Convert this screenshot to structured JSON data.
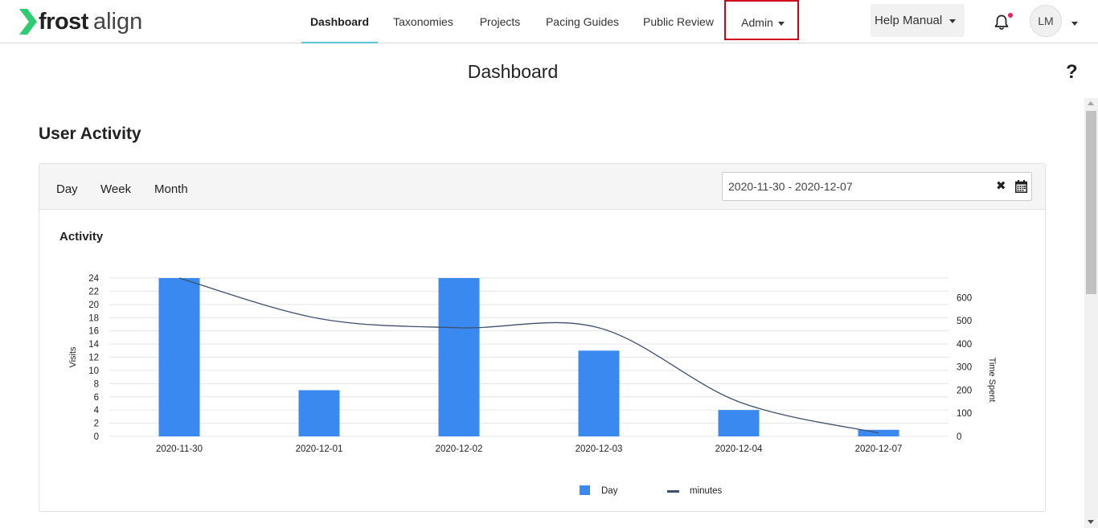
{
  "app": {
    "logo_word1": "frost",
    "logo_word2": "align"
  },
  "nav": {
    "items": [
      {
        "label": "Dashboard"
      },
      {
        "label": "Taxonomies"
      },
      {
        "label": "Projects"
      },
      {
        "label": "Pacing Guides"
      },
      {
        "label": "Public Review"
      },
      {
        "label": "Admin"
      }
    ],
    "active": "Dashboard",
    "help_label": "Help Manual",
    "avatar_initials": "LM",
    "accent_color": "#5bc5d6",
    "highlight_color": "#d0021b"
  },
  "page": {
    "title": "Dashboard",
    "help_icon": "?"
  },
  "user_activity": {
    "title": "User Activity",
    "range_buttons": [
      "Day",
      "Week",
      "Month"
    ],
    "date_range": "2020-11-30 - 2020-12-07",
    "clear_icon": "✖",
    "card_title": "Activity"
  },
  "chart_data": {
    "type": "bar",
    "categories": [
      "2020-11-30",
      "2020-12-01",
      "2020-12-02",
      "2020-12-03",
      "2020-12-04",
      "2020-12-07"
    ],
    "series": [
      {
        "name": "Day",
        "kind": "bar",
        "axis": "left",
        "color": "#3a89f0",
        "values": [
          24,
          7,
          24,
          13,
          4,
          1
        ]
      },
      {
        "name": "minutes",
        "kind": "line",
        "axis": "right",
        "color": "#3f4f6e",
        "values": [
          685,
          510,
          470,
          470,
          150,
          15
        ]
      }
    ],
    "ylabel": "Visits",
    "ylabel_right": "Time Spent",
    "ylim": [
      0,
      24
    ],
    "yticks": [
      0,
      2,
      4,
      6,
      8,
      10,
      12,
      14,
      16,
      18,
      20,
      22,
      24
    ],
    "ylim_right": [
      0,
      685
    ],
    "yticks_right": [
      0,
      100,
      200,
      300,
      400,
      500,
      600
    ],
    "legend_position": "bottom",
    "grid": true
  }
}
